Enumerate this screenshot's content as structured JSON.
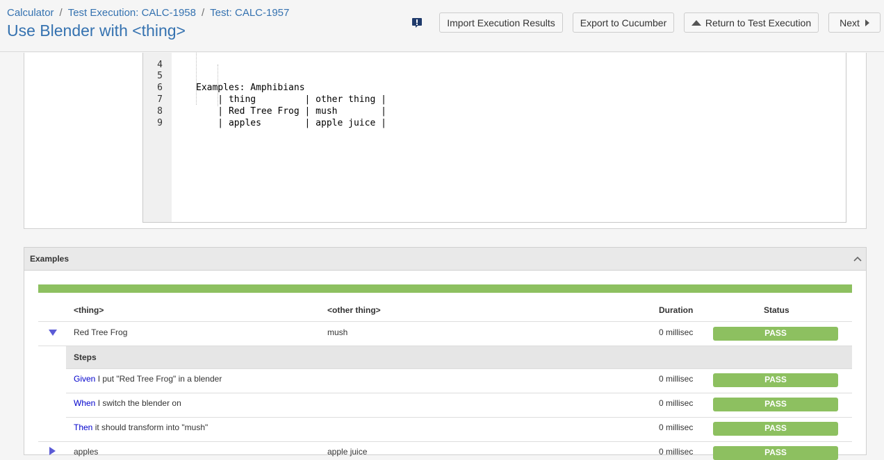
{
  "breadcrumb": {
    "project": "Calculator",
    "execution": "Test Execution: CALC-1958",
    "test": "Test: CALC-1957",
    "separator": "/"
  },
  "page_title": "Use Blender with <thing>",
  "toolbar": {
    "import_label": "Import Execution Results",
    "export_label": "Export to Cucumber",
    "return_label": "Return to Test Execution",
    "next_label": "Next"
  },
  "code": {
    "lines": [
      {
        "n": "4",
        "text": ""
      },
      {
        "n": "5",
        "text": "Examples: Amphibians"
      },
      {
        "n": "6",
        "text": "    | thing         | other thing |"
      },
      {
        "n": "7",
        "text": "    | Red Tree Frog | mush        |"
      },
      {
        "n": "8",
        "text": "    | apples        | apple juice |"
      },
      {
        "n": "9",
        "text": ""
      }
    ]
  },
  "examples": {
    "title": "Examples",
    "columns": {
      "thing": "<thing>",
      "other": "<other thing>",
      "duration": "Duration",
      "status": "Status"
    },
    "rows": [
      {
        "thing": "Red Tree Frog",
        "other": "mush",
        "duration": "0 millisec",
        "status": "PASS"
      },
      {
        "thing": "apples",
        "other": "apple juice",
        "duration": "0 millisec",
        "status": "PASS"
      }
    ],
    "steps_label": "Steps",
    "steps": [
      {
        "keyword": "Given",
        "text": " I put \"Red Tree Frog\" in a blender",
        "duration": "0 millisec",
        "status": "PASS"
      },
      {
        "keyword": "When",
        "text": " I switch the blender on",
        "duration": "0 millisec",
        "status": "PASS"
      },
      {
        "keyword": "Then",
        "text": " it should transform into \"mush\"",
        "duration": "0 millisec",
        "status": "PASS"
      }
    ],
    "progress_pass_fraction": 1.0
  },
  "colors": {
    "link": "#3572b0",
    "pass": "#8dc060",
    "step_keyword": "#0000cc"
  },
  "icons": {
    "feedback": "feedback-icon",
    "collapse": "chevron-up-icon",
    "expand_open": "triangle-down-icon",
    "expand_closed": "triangle-right-icon"
  }
}
